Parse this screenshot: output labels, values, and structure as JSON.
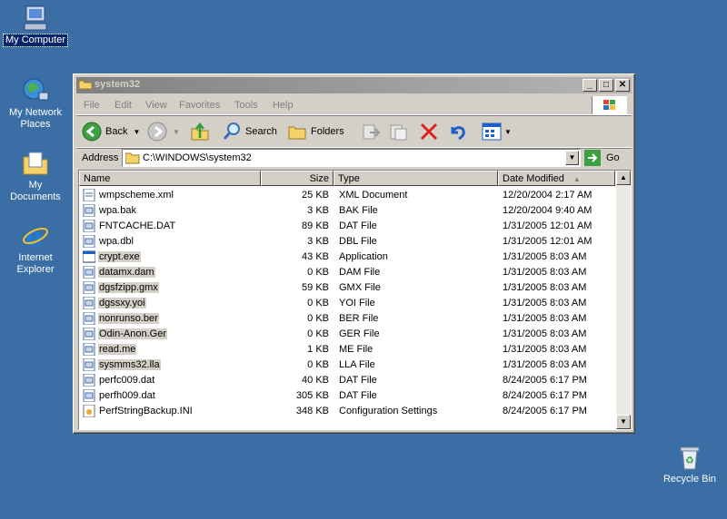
{
  "desktop": {
    "icons": [
      {
        "label": "My Computer"
      },
      {
        "label": "My Network Places"
      },
      {
        "label": "My Documents"
      },
      {
        "label": "Internet Explorer"
      },
      {
        "label": "Recycle Bin"
      }
    ]
  },
  "window": {
    "title": "system32",
    "menu": [
      "File",
      "Edit",
      "View",
      "Favorites",
      "Tools",
      "Help"
    ],
    "toolbar": {
      "back": "Back",
      "search": "Search",
      "folders": "Folders"
    },
    "address": {
      "label": "Address",
      "value": "C:\\WINDOWS\\system32",
      "go": "Go"
    },
    "columns": [
      "Name",
      "Size",
      "Type",
      "Date Modified"
    ],
    "files": [
      {
        "name": "wmpscheme.xml",
        "size": "25 KB",
        "type": "XML Document",
        "date": "12/20/2004 2:17 AM",
        "selected": false
      },
      {
        "name": "wpa.bak",
        "size": "3 KB",
        "type": "BAK File",
        "date": "12/20/2004 9:40 AM",
        "selected": false
      },
      {
        "name": "FNTCACHE.DAT",
        "size": "89 KB",
        "type": "DAT File",
        "date": "1/31/2005 12:01 AM",
        "selected": false
      },
      {
        "name": "wpa.dbl",
        "size": "3 KB",
        "type": "DBL File",
        "date": "1/31/2005 12:01 AM",
        "selected": false
      },
      {
        "name": "crypt.exe",
        "size": "43 KB",
        "type": "Application",
        "date": "1/31/2005 8:03 AM",
        "selected": true
      },
      {
        "name": "datamx.dam",
        "size": "0 KB",
        "type": "DAM File",
        "date": "1/31/2005 8:03 AM",
        "selected": true
      },
      {
        "name": "dgsfzipp.gmx",
        "size": "59 KB",
        "type": "GMX File",
        "date": "1/31/2005 8:03 AM",
        "selected": true
      },
      {
        "name": "dgssxy.yoi",
        "size": "0 KB",
        "type": "YOI File",
        "date": "1/31/2005 8:03 AM",
        "selected": true
      },
      {
        "name": "nonrunso.ber",
        "size": "0 KB",
        "type": "BER File",
        "date": "1/31/2005 8:03 AM",
        "selected": true
      },
      {
        "name": "Odin-Anon.Ger",
        "size": "0 KB",
        "type": "GER File",
        "date": "1/31/2005 8:03 AM",
        "selected": true
      },
      {
        "name": "read.me",
        "size": "1 KB",
        "type": "ME File",
        "date": "1/31/2005 8:03 AM",
        "selected": true
      },
      {
        "name": "sysmms32.lla",
        "size": "0 KB",
        "type": "LLA File",
        "date": "1/31/2005 8:03 AM",
        "selected": true
      },
      {
        "name": "perfc009.dat",
        "size": "40 KB",
        "type": "DAT File",
        "date": "8/24/2005 6:17 PM",
        "selected": false
      },
      {
        "name": "perfh009.dat",
        "size": "305 KB",
        "type": "DAT File",
        "date": "8/24/2005 6:17 PM",
        "selected": false
      },
      {
        "name": "PerfStringBackup.INI",
        "size": "348 KB",
        "type": "Configuration Settings",
        "date": "8/24/2005 6:17 PM",
        "selected": false
      }
    ]
  }
}
